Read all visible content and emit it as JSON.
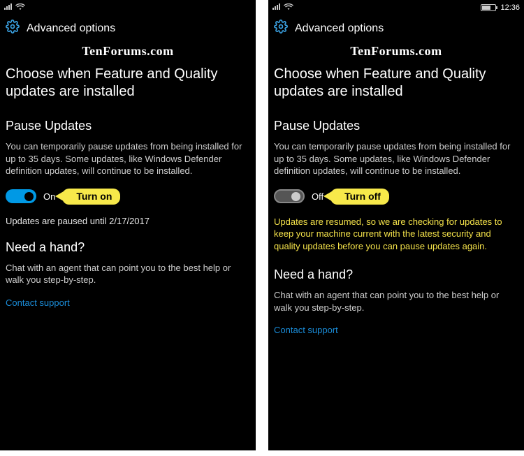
{
  "watermark": "TenForums.com",
  "clock": "12:36",
  "header": {
    "title": "Advanced options"
  },
  "main_heading": "Choose when Feature and Quality updates are installed",
  "pause": {
    "heading": "Pause Updates",
    "desc": "You can temporarily pause updates from being installed for up to 35 days. Some updates, like Windows Defender definition updates, will continue to be installed."
  },
  "left": {
    "toggle_state": "On",
    "callout": "Turn on",
    "paused_until": "Updates are paused until 2/17/2017"
  },
  "right": {
    "toggle_state": "Off",
    "callout": "Turn off",
    "resume_note": "Updates are resumed, so we are checking for updates to keep your machine current with the latest security and quality updates before you can pause updates again."
  },
  "help": {
    "heading": "Need a hand?",
    "desc": "Chat with an agent that can point you to the best help or walk you step-by-step.",
    "link": "Contact support"
  }
}
